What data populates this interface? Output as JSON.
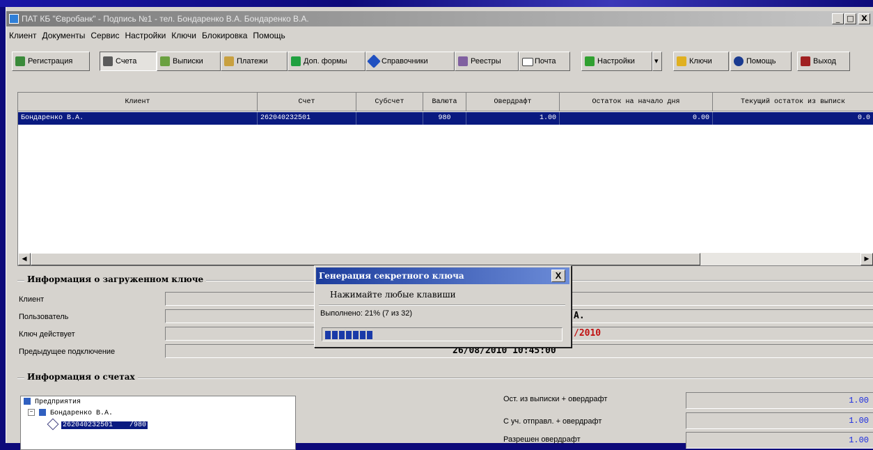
{
  "window": {
    "title": "ПАТ КБ \"Євробанк\" - Подпись №1 - тел. Бондаренко В.А.   Бондаренко В.А.",
    "minimize": "_",
    "maximize": "□",
    "close": "X"
  },
  "menu": [
    "Клиент",
    "Документы",
    "Сервис",
    "Настройки",
    "Ключи",
    "Блокировка",
    "Помощь"
  ],
  "toolbar": {
    "registration": "Регистрация",
    "accounts": "Счета",
    "statements": "Выписки",
    "payments": "Платежи",
    "extra_forms": "Доп. формы",
    "reference": "Справочники",
    "registers": "Реестры",
    "mail": "Почта",
    "settings": "Настройки",
    "keys": "Ключи",
    "help": "Помощь",
    "exit": "Выход"
  },
  "accounts_table": {
    "headers": [
      "Клиент",
      "Счет",
      "Субсчет",
      "Валюта",
      "Овердрафт",
      "Остаток на начало дня",
      "Текущий остаток из выписк"
    ],
    "rows": [
      {
        "client": "Бондаренко В.А.",
        "account": "262040232501",
        "subaccount": "",
        "currency": "980",
        "overdraft": "1.00",
        "opening_balance": "0.00",
        "current_balance": "0.0"
      }
    ]
  },
  "key_info": {
    "title": "Информация о загруженном ключе",
    "labels": [
      "Клиент",
      "Пользователь",
      "Ключ действует",
      "Предыдущее подключение"
    ],
    "user_value": "А.",
    "valid_value": "/2010",
    "previous_value": "26/08/2010 10:45:00"
  },
  "accounts_info": {
    "title": "Информация о счетах",
    "tree": {
      "root": "Предприятия",
      "client": "Бондаренко В.А.",
      "account": "262040232501",
      "currency": "/980"
    },
    "balances": [
      {
        "label": "Ост. из выписки + овердрафт",
        "value": "1.00"
      },
      {
        "label": "С уч. отправл. + овердрафт",
        "value": "1.00"
      },
      {
        "label": "Разрешен овердрафт",
        "value": "1.00"
      }
    ]
  },
  "dialog": {
    "title": "Генерация секретного ключа",
    "close": "X",
    "instruction": "Нажимайте любые клавиши",
    "progress_text": "Выполнено: 21% (7 из 32)",
    "progress_done": 7,
    "progress_total": 32,
    "progress_percent": 21
  },
  "colors": {
    "selection": "#0a1a80",
    "accent_red": "#c01010",
    "balance_blue": "#1a2ae0"
  }
}
